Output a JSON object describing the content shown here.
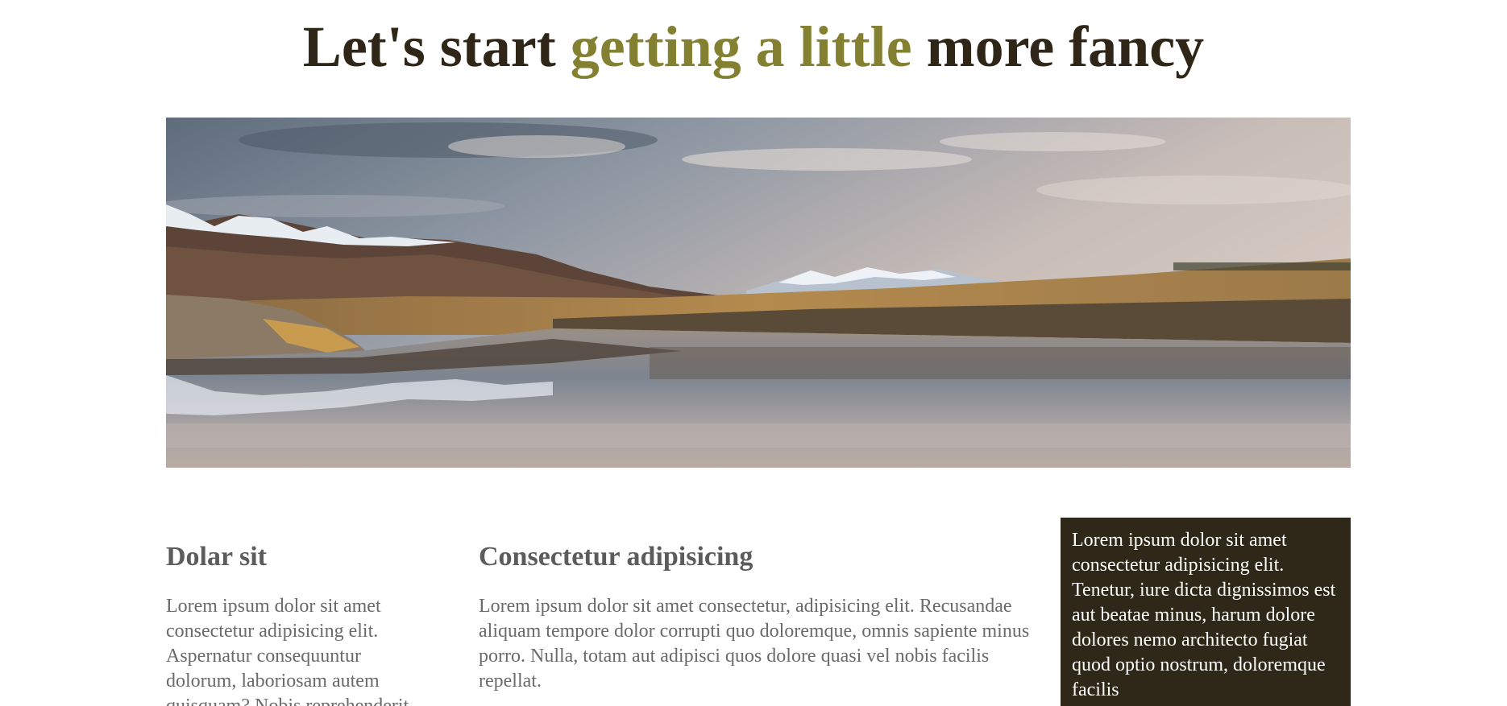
{
  "header": {
    "title_before": "Let's start ",
    "title_accent": "getting a little",
    "title_after": " more fancy",
    "accent_color": "#848031",
    "title_color": "#2f2617"
  },
  "hero_image": {
    "subject": "mountain lake landscape with snowy peaks reflected in water"
  },
  "columns": [
    {
      "heading": "Dolar sit",
      "body": "Lorem ipsum dolor sit amet consectetur adipisicing elit. Aspernatur consequuntur dolorum, laboriosam autem quisquam? Nobis reprehenderit"
    },
    {
      "heading": "Consectetur adipisicing",
      "body": "Lorem ipsum dolor sit amet consectetur, adipisicing elit. Recusandae aliquam tempore dolor corrupti quo doloremque, omnis sapiente minus porro. Nulla, totam aut adipisci quos dolore quasi vel nobis facilis repellat."
    }
  ],
  "aside": {
    "text": "Lorem ipsum dolor sit amet consectetur adipisicing elit. Tenetur, iure dicta dignissimos est aut beatae minus, harum dolore dolores nemo architecto fugiat quod optio nostrum, doloremque facilis",
    "background": "#2f2717"
  }
}
